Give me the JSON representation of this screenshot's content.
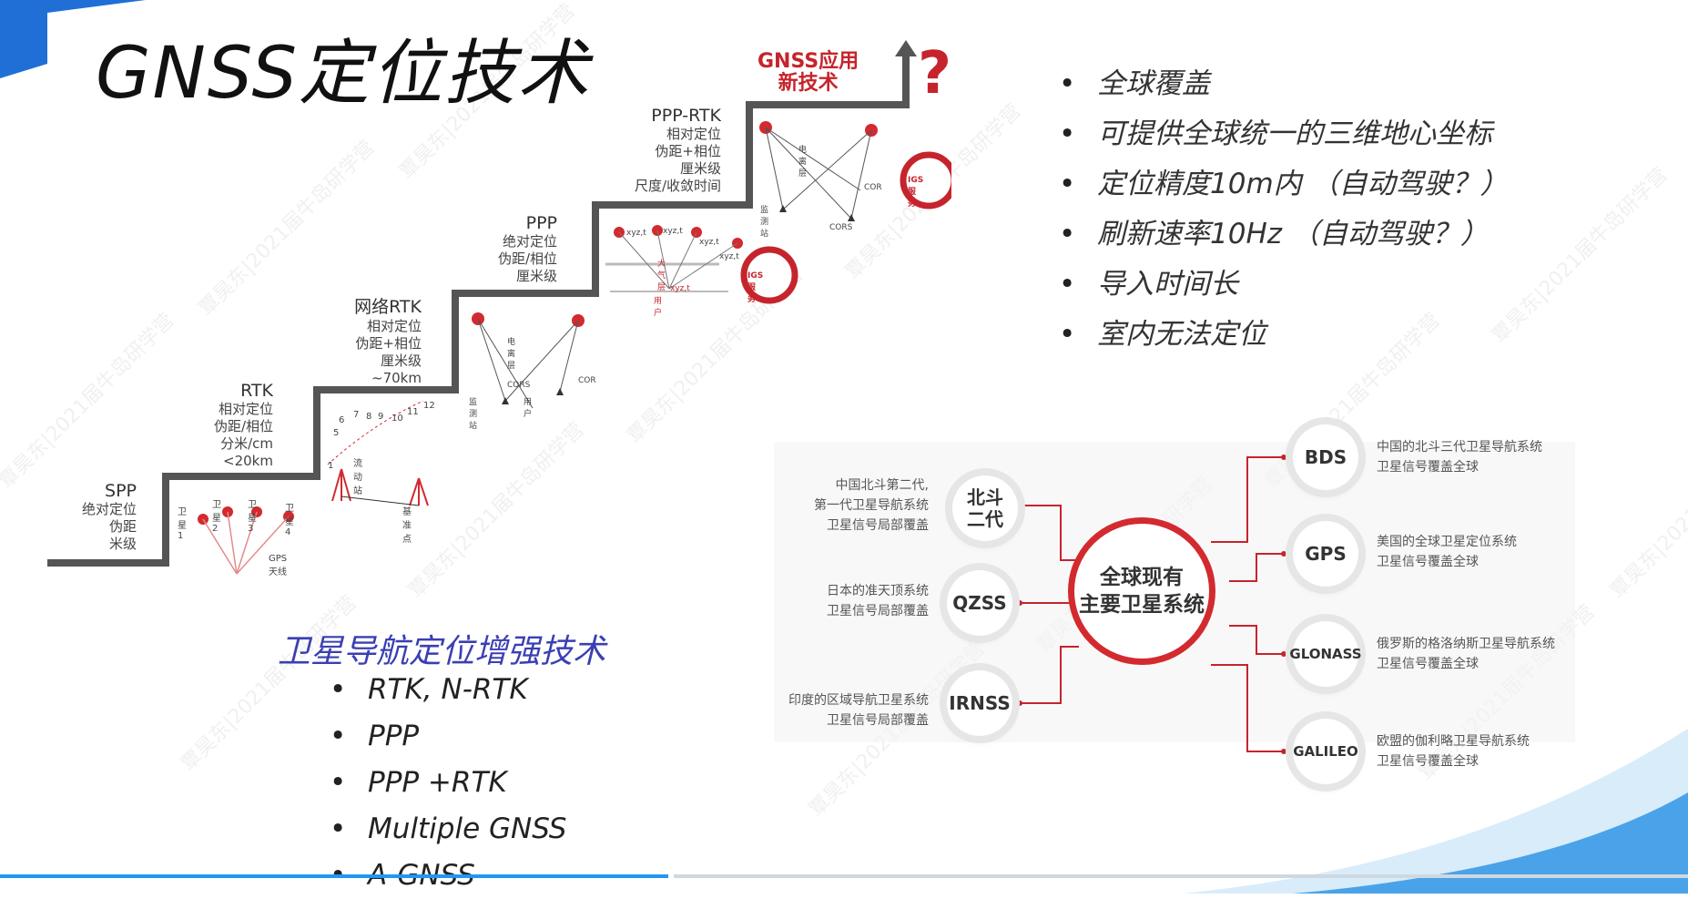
{
  "title": "GNSS定位技术",
  "stairs": {
    "new_tech": [
      "GNSS应用",
      "新技术"
    ],
    "question": "?",
    "steps": [
      {
        "name": "SPP",
        "desc": [
          "绝对定位",
          "伪距",
          "米级"
        ]
      },
      {
        "name": "RTK",
        "desc": [
          "相对定位",
          "伪距/相位",
          "分米/cm",
          "<20km"
        ]
      },
      {
        "name": "网络RTK",
        "desc": [
          "相对定位",
          "伪距+相位",
          "厘米级",
          "~70km"
        ]
      },
      {
        "name": "PPP",
        "desc": [
          "绝对定位",
          "伪距/相位",
          "厘米级"
        ]
      },
      {
        "name": "PPP-RTK",
        "desc": [
          "相对定位",
          "伪距+相位",
          "厘米级",
          "尺度/收敛时间"
        ]
      }
    ],
    "small_labels": {
      "satellites": [
        "卫星1",
        "卫星2",
        "卫星3",
        "卫星4"
      ],
      "gps_antenna": "GPS天线",
      "rover": "流动站",
      "base": "基准点",
      "numbers": [
        "1",
        "2",
        "3",
        "4",
        "5",
        "6",
        "7",
        "8",
        "9",
        "10",
        "11",
        "12"
      ],
      "ionosphere": "电离层",
      "monitor": "监测站",
      "cors": "CORS",
      "cor": "COR",
      "user": "用户",
      "xyzt": "xyz,t",
      "troposphere": "大气层",
      "igs": "IGS服务"
    }
  },
  "right_bullets": [
    "全球覆盖",
    "可提供全球统一的三维地心坐标",
    "定位精度10m内   （自动驾驶？）",
    "刷新速率10Hz    （自动驾驶？）",
    "导入时间长",
    "室内无法定位"
  ],
  "augmentation": {
    "title": "卫星导航定位增强技术",
    "items": [
      "RTK,  N-RTK",
      "PPP",
      "PPP +RTK",
      "Multiple  GNSS",
      "A-GNSS"
    ]
  },
  "systems": {
    "center": [
      "全球现有",
      "主要卫星系统"
    ],
    "left": [
      {
        "name": "北斗\n二代",
        "desc": [
          "中国北斗第二代,",
          "第一代卫星导航系统",
          "卫星信号局部覆盖"
        ]
      },
      {
        "name": "QZSS",
        "desc": [
          "日本的准天顶系统",
          "卫星信号局部覆盖"
        ]
      },
      {
        "name": "IRNSS",
        "desc": [
          "印度的区域导航卫星系统",
          "卫星信号局部覆盖"
        ]
      }
    ],
    "right": [
      {
        "name": "BDS",
        "desc": [
          "中国的北斗三代卫星导航系统",
          "卫星信号覆盖全球"
        ]
      },
      {
        "name": "GPS",
        "desc": [
          "美国的全球卫星定位系统",
          "卫星信号覆盖全球"
        ]
      },
      {
        "name": "GLONASS",
        "desc": [
          "俄罗斯的格洛纳斯卫星导航系统",
          "卫星信号覆盖全球"
        ]
      },
      {
        "name": "GALILEO",
        "desc": [
          "欧盟的伽利略卫星导航系统",
          "卫星信号覆盖全球"
        ]
      }
    ]
  },
  "watermark": "覃昊东|2021届牛岛研学营",
  "colors": {
    "accent_red": "#c6242c",
    "aug_title_blue": "#3a3fb3",
    "progress_blue": "#2196f3"
  },
  "video": {
    "progress_fraction": 0.396
  }
}
